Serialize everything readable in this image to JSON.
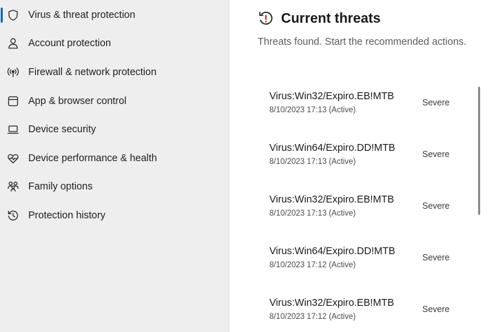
{
  "colors": {
    "accent": "#0067c0",
    "sidebar_bg": "#eeeeee",
    "threat_icon_red": "#c42b1c"
  },
  "sidebar": {
    "items": [
      {
        "label": "Virus & threat protection",
        "icon": "shield-icon",
        "active": true
      },
      {
        "label": "Account protection",
        "icon": "person-icon",
        "active": false
      },
      {
        "label": "Firewall & network protection",
        "icon": "wifi-antenna-icon",
        "active": false
      },
      {
        "label": "App & browser control",
        "icon": "browser-window-icon",
        "active": false
      },
      {
        "label": "Device security",
        "icon": "laptop-icon",
        "active": false
      },
      {
        "label": "Device performance & health",
        "icon": "heart-pulse-icon",
        "active": false
      },
      {
        "label": "Family options",
        "icon": "family-icon",
        "active": false
      },
      {
        "label": "Protection history",
        "icon": "history-icon",
        "active": false
      }
    ]
  },
  "main": {
    "title": "Current threats",
    "title_icon": "threat-warning-icon",
    "subtitle": "Threats found. Start the recommended actions.",
    "threats": [
      {
        "name": "Virus:Win32/Expiro.EB!MTB",
        "meta": "8/10/2023 17:13 (Active)",
        "severity": "Severe"
      },
      {
        "name": "Virus:Win64/Expiro.DD!MTB",
        "meta": "8/10/2023 17:13 (Active)",
        "severity": "Severe"
      },
      {
        "name": "Virus:Win32/Expiro.EB!MTB",
        "meta": "8/10/2023 17:13 (Active)",
        "severity": "Severe"
      },
      {
        "name": "Virus:Win64/Expiro.DD!MTB",
        "meta": "8/10/2023 17:12 (Active)",
        "severity": "Severe"
      },
      {
        "name": "Virus:Win32/Expiro.EB!MTB",
        "meta": "8/10/2023 17:12 (Active)",
        "severity": "Severe"
      }
    ]
  }
}
